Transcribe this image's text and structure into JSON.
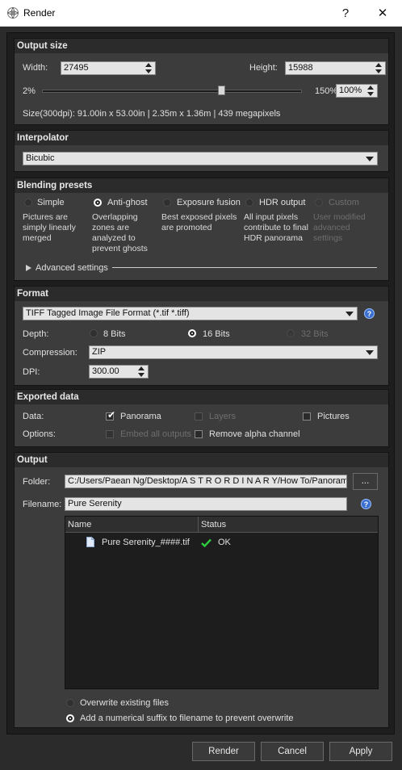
{
  "window": {
    "title": "Render",
    "help_label": "?",
    "close_label": "✕"
  },
  "output_size": {
    "header": "Output size",
    "width_label": "Width:",
    "width_value": "27495",
    "height_label": "Height:",
    "height_value": "15988",
    "scale_min": "2%",
    "scale_max": "150%",
    "zoom_value": "100%",
    "slider_level": 0.69,
    "size_info": "Size(300dpi): 91.00in x  53.00in |  2.35m x  1.36m | 439 megapixels"
  },
  "interpolator": {
    "header": "Interpolator",
    "value": "Bicubic"
  },
  "blending": {
    "header": "Blending presets",
    "presets": [
      {
        "label": "Simple",
        "desc": "Pictures are simply linearly merged",
        "selected": false,
        "disabled": false
      },
      {
        "label": "Anti-ghost",
        "desc": "Overlapping zones are analyzed to prevent ghosts",
        "selected": true,
        "disabled": false
      },
      {
        "label": "Exposure fusion",
        "desc": "Best exposed pixels are promoted",
        "selected": false,
        "disabled": false
      },
      {
        "label": "HDR output",
        "desc": "All input pixels contribute to final HDR panorama",
        "selected": false,
        "disabled": false
      },
      {
        "label": "Custom",
        "desc": "User modified advanced settings",
        "selected": false,
        "disabled": true
      }
    ],
    "advanced_label": "Advanced settings"
  },
  "format": {
    "header": "Format",
    "format_value": "TIFF Tagged Image File Format (*.tif *.tiff)",
    "depth_label": "Depth:",
    "depth_options": [
      {
        "label": "8 Bits",
        "selected": false,
        "disabled": false
      },
      {
        "label": "16 Bits",
        "selected": true,
        "disabled": false
      },
      {
        "label": "32 Bits",
        "selected": false,
        "disabled": true
      }
    ],
    "compression_label": "Compression:",
    "compression_value": "ZIP",
    "dpi_label": "DPI:",
    "dpi_value": "300.00"
  },
  "exported": {
    "header": "Exported data",
    "data_label": "Data:",
    "options_label": "Options:",
    "panorama": {
      "label": "Panorama",
      "checked": true,
      "disabled": false
    },
    "layers": {
      "label": "Layers",
      "checked": false,
      "disabled": true
    },
    "pictures": {
      "label": "Pictures",
      "checked": false,
      "disabled": false
    },
    "embed": {
      "label": "Embed all outputs",
      "checked": false,
      "disabled": true
    },
    "remove_alpha": {
      "label": "Remove alpha channel",
      "checked": false,
      "disabled": false
    }
  },
  "output": {
    "header": "Output",
    "folder_label": "Folder:",
    "folder_value": "C:/Users/Paean Ng/Desktop/A S T R O R D I N A R Y/How To/Panoramas",
    "browse_label": "...",
    "filename_label": "Filename:",
    "filename_value": "Pure Serenity",
    "columns": [
      "Name",
      "Status"
    ],
    "rows": [
      {
        "name": "Pure Serenity_####.tif",
        "status": "OK"
      }
    ],
    "overwrite_label": "Overwrite existing files",
    "suffix_label": "Add a numerical suffix to filename to prevent overwrite",
    "overwrite_selected": false,
    "suffix_selected": true
  },
  "buttons": {
    "render": "Render",
    "cancel": "Cancel",
    "apply": "Apply"
  },
  "colors": {
    "accent_blue": "#3a6fd0",
    "ok_green": "#2ecc40",
    "panel_bg": "#3c3c3c",
    "dialog_bg": "#1e1e1e"
  }
}
